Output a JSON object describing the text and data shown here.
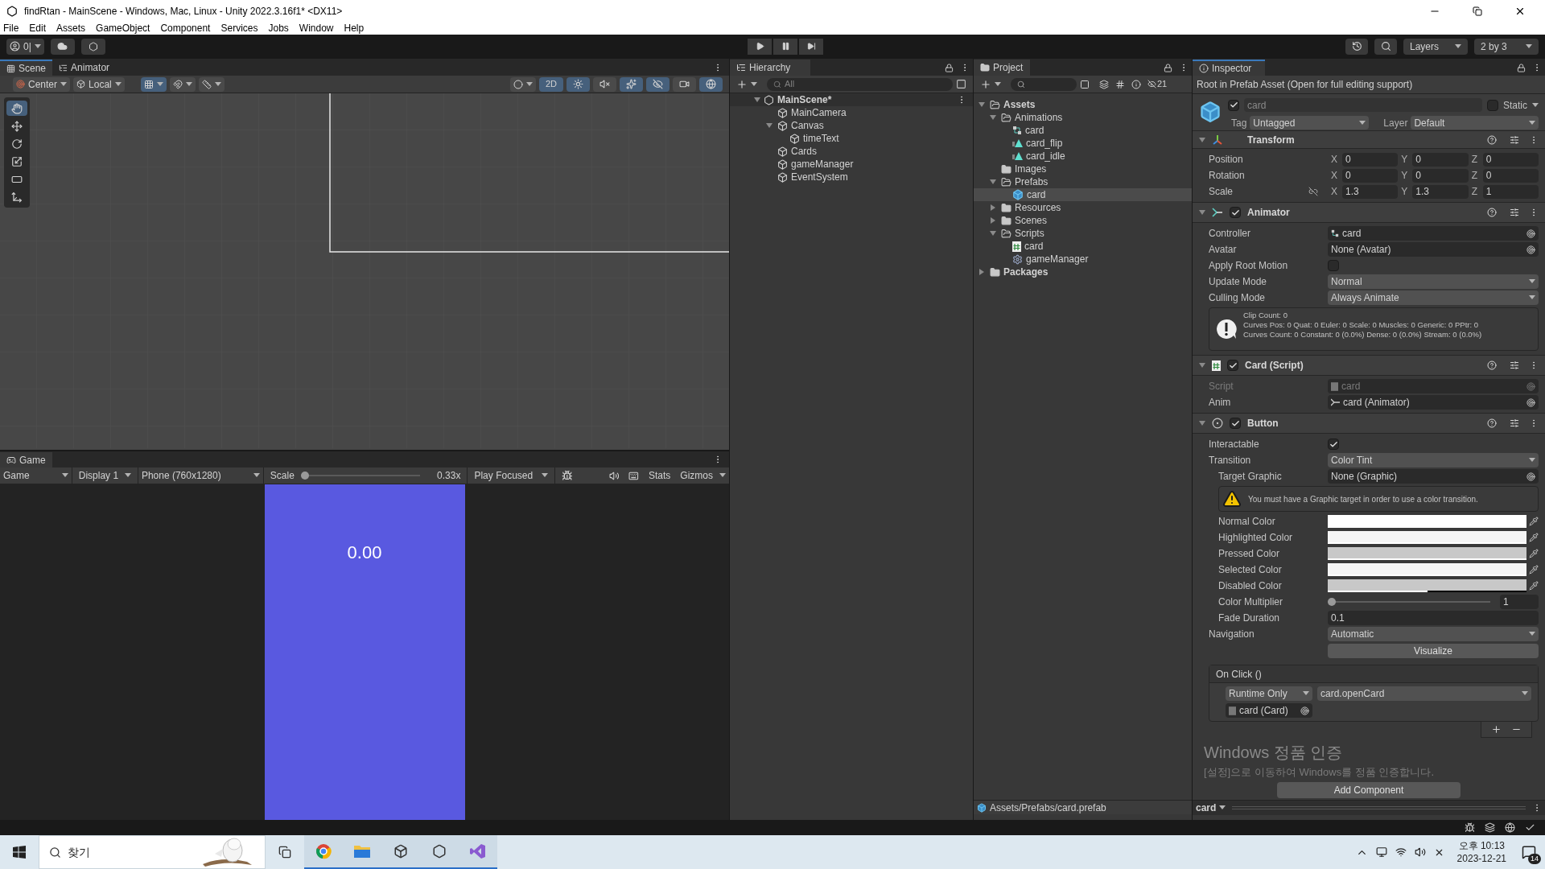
{
  "window": {
    "title": "findRtan - MainScene - Windows, Mac, Linux - Unity 2022.3.16f1* <DX11>"
  },
  "menu": [
    "File",
    "Edit",
    "Assets",
    "GameObject",
    "Component",
    "Services",
    "Jobs",
    "Window",
    "Help"
  ],
  "toolbar": {
    "account": "0|",
    "layers": "Layers",
    "layout": "2 by 3"
  },
  "scene": {
    "tabs": [
      {
        "label": "Scene",
        "selected": true
      },
      {
        "label": "Animator",
        "selected": false
      }
    ],
    "pivot": "Center",
    "space": "Local",
    "mode_2d": {
      "label": "2D",
      "on": true
    },
    "toggles": [
      {
        "kind": "lighting",
        "on": true
      },
      {
        "kind": "audio",
        "on": false
      },
      {
        "kind": "effects",
        "on": true
      },
      {
        "kind": "visibility",
        "on": true
      },
      {
        "kind": "camera",
        "on": false
      },
      {
        "kind": "gizmos",
        "on": true
      }
    ],
    "tools": [
      {
        "kind": "hand",
        "selected": true
      },
      {
        "kind": "move",
        "selected": false
      },
      {
        "kind": "rotate",
        "selected": false
      },
      {
        "kind": "scale",
        "selected": false
      },
      {
        "kind": "rect",
        "selected": false
      },
      {
        "kind": "transform",
        "selected": false
      }
    ]
  },
  "game": {
    "tab": "Game",
    "view": "Game",
    "display": "Display 1",
    "resolution": "Phone (760x1280)",
    "scale_label": "Scale",
    "scale": {
      "level": 0
    },
    "scale_reading": "0.33x",
    "play_mode": "Play Focused",
    "stats": "Stats",
    "gizmos": "Gizmos",
    "timer": "0.00"
  },
  "hierarchy": {
    "title": "Hierarchy",
    "search_placeholder": "All",
    "scene": "MainScene*",
    "items": [
      {
        "label": "MainCamera"
      },
      {
        "label": "Canvas",
        "expanded": true,
        "children": [
          {
            "label": "timeText"
          }
        ]
      },
      {
        "label": "Cards"
      },
      {
        "label": "gameManager"
      },
      {
        "label": "EventSystem"
      }
    ]
  },
  "project": {
    "title": "Project",
    "hidden_count": "21",
    "path": "Assets/Prefabs/card.prefab",
    "items": [
      {
        "label": "Assets",
        "kind": "folder",
        "expanded": true,
        "selected": false,
        "children": [
          {
            "label": "Animations",
            "kind": "folder",
            "expanded": true,
            "selected": false,
            "children": [
              {
                "label": "card",
                "kind": "controller",
                "selected": false
              },
              {
                "label": "card_flip",
                "kind": "clip",
                "selected": false
              },
              {
                "label": "card_idle",
                "kind": "clip",
                "selected": false
              }
            ]
          },
          {
            "label": "Images",
            "kind": "folder",
            "selected": false
          },
          {
            "label": "Prefabs",
            "kind": "folder",
            "expanded": true,
            "selected": false,
            "children": [
              {
                "label": "card",
                "kind": "prefab",
                "selected": true
              }
            ]
          },
          {
            "label": "Resources",
            "kind": "folder",
            "expanded": false,
            "selected": false
          },
          {
            "label": "Scenes",
            "kind": "folder",
            "expanded": false,
            "selected": false
          },
          {
            "label": "Scripts",
            "kind": "folder",
            "expanded": true,
            "selected": false,
            "children": [
              {
                "label": "card",
                "kind": "script",
                "selected": false
              },
              {
                "label": "gameManager",
                "kind": "settings",
                "selected": false
              }
            ]
          }
        ]
      },
      {
        "label": "Packages",
        "kind": "folder",
        "expanded": false,
        "selected": false
      }
    ]
  },
  "inspector": {
    "title": "Inspector",
    "notice": "Root in Prefab Asset (Open for full editing support)",
    "object": {
      "active": true,
      "name": "card",
      "static": {
        "label": "Static",
        "checked": false
      },
      "tag_label": "Tag",
      "tag": "Untagged",
      "layer_label": "Layer",
      "layer": "Default"
    },
    "transform": {
      "title": "Transform",
      "rows": [
        {
          "label": "Position",
          "fields": [
            {
              "axis": "X",
              "value": "0"
            },
            {
              "axis": "Y",
              "value": "0"
            },
            {
              "axis": "Z",
              "value": "0"
            }
          ]
        },
        {
          "label": "Rotation",
          "fields": [
            {
              "axis": "X",
              "value": "0"
            },
            {
              "axis": "Y",
              "value": "0"
            },
            {
              "axis": "Z",
              "value": "0"
            }
          ]
        },
        {
          "label": "Scale",
          "proportion_lock": false,
          "fields": [
            {
              "axis": "X",
              "value": "1.3"
            },
            {
              "axis": "Y",
              "value": "1.3"
            },
            {
              "axis": "Z",
              "value": "1"
            }
          ]
        }
      ]
    },
    "components": [
      {
        "kind": "animator",
        "title": "Animator",
        "enabled": true,
        "fields": [
          {
            "kind": "object",
            "label": "Controller",
            "value": "card"
          },
          {
            "kind": "object",
            "label": "Avatar",
            "value": "None (Avatar)"
          },
          {
            "kind": "checkbox",
            "label": "Apply Root Motion",
            "checked": false
          },
          {
            "kind": "dropdown",
            "label": "Update Mode",
            "value": "Normal"
          },
          {
            "kind": "dropdown",
            "label": "Culling Mode",
            "value": "Always Animate"
          },
          {
            "kind": "info",
            "lines": [
              "Clip Count: 0",
              "Curves Pos: 0 Quat: 0 Euler: 0 Scale: 0 Muscles: 0 Generic: 0 PPtr: 0",
              "Curves Count: 0 Constant: 0 (0.0%) Dense: 0 (0.0%) Stream: 0 (0.0%)"
            ]
          }
        ]
      },
      {
        "kind": "script",
        "title": "Card (Script)",
        "enabled": true,
        "fields": [
          {
            "kind": "object",
            "label": "Script",
            "value": "card",
            "disabled": true
          },
          {
            "kind": "object",
            "label": "Anim",
            "value": "card (Animator)",
            "disabled": false
          }
        ]
      },
      {
        "kind": "button",
        "title": "Button",
        "enabled": true,
        "fields": [
          {
            "kind": "checkbox",
            "label": "Interactable",
            "checked": true
          },
          {
            "kind": "dropdown",
            "label": "Transition",
            "value": "Color Tint",
            "children": [
              {
                "kind": "object",
                "label": "Target Graphic",
                "value": "None (Graphic)"
              },
              {
                "kind": "warning",
                "text": "You must have a Graphic target in order to use a color transition."
              },
              {
                "kind": "color",
                "label": "Normal Color",
                "color": "#ffffff",
                "level": 1
              },
              {
                "kind": "color",
                "label": "Highlighted Color",
                "color": "#f5f5f5",
                "level": 1
              },
              {
                "kind": "color",
                "label": "Pressed Color",
                "color": "#c8c8c8",
                "level": 1
              },
              {
                "kind": "color",
                "label": "Selected Color",
                "color": "#f5f5f5",
                "level": 1
              },
              {
                "kind": "color",
                "label": "Disabled Color",
                "color": "#c8c8c8",
                "level": 0.5
              },
              {
                "kind": "slider",
                "label": "Color Multiplier",
                "level": 0,
                "reading": "1"
              },
              {
                "kind": "text",
                "label": "Fade Duration",
                "value": "0.1"
              }
            ]
          },
          {
            "kind": "dropdown",
            "label": "Navigation",
            "value": "Automatic"
          },
          {
            "kind": "button",
            "label": "Visualize"
          }
        ],
        "on_click": {
          "title": "On Click ()",
          "entries": [
            {
              "mode": "Runtime Only",
              "function": "card.openCard",
              "target": "card (Card)"
            }
          ]
        }
      }
    ],
    "add_component": "Add Component",
    "preview": "card"
  },
  "activation_notice": {
    "title": "Windows 정품 인증",
    "text": "[설정]으로 이동하여 Windows를 정품 인증합니다."
  },
  "taskbar": {
    "search_placeholder": "찾기",
    "time": "오후 10:13",
    "date": "2023-12-21",
    "notifications": "14"
  }
}
